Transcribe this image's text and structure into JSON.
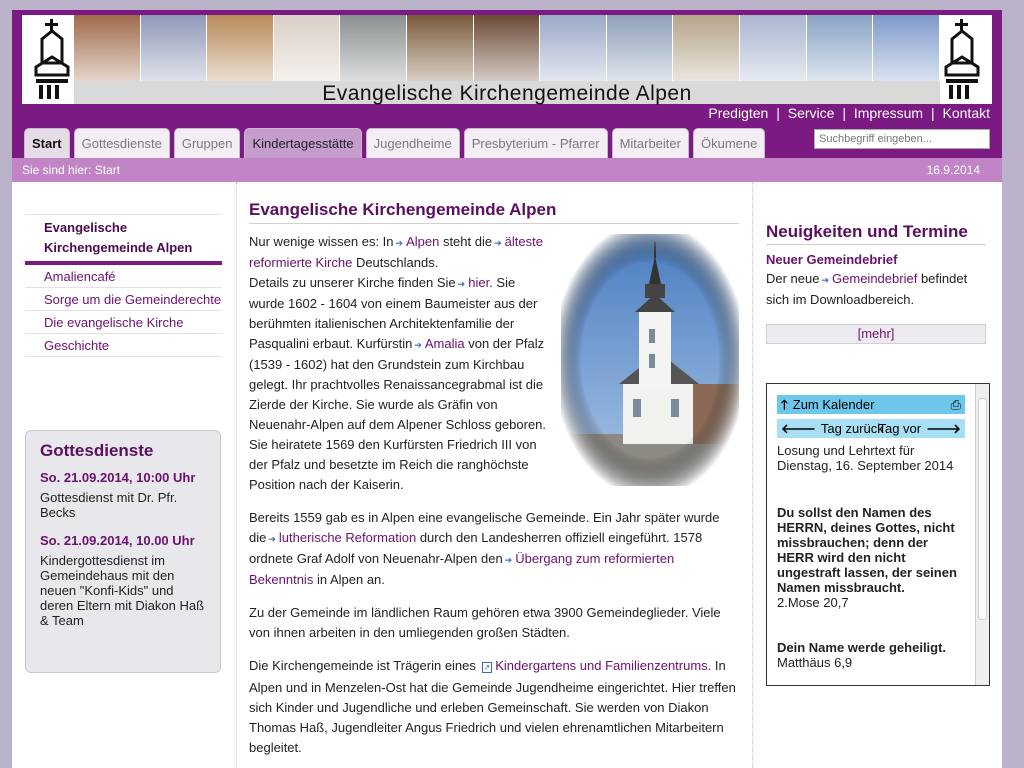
{
  "header": {
    "site_title": "Evangelische Kirchengemeinde Alpen",
    "photo_colors": [
      "#a06a4a",
      "#8f98b8",
      "#b88a5a",
      "#d9cfc4",
      "#8a8f90",
      "#7a5a3a",
      "#6b4a36",
      "#9aa9c8",
      "#8fa0b8",
      "#b5a48a",
      "#a9b6cf",
      "#8aa2c5",
      "#7e9acb"
    ]
  },
  "topnav": {
    "items": [
      "Predigten",
      "Service",
      "Impressum",
      "Kontakt"
    ],
    "separator": "|"
  },
  "tabs": [
    {
      "label": "Start"
    },
    {
      "label": "Gottesdienste"
    },
    {
      "label": "Gruppen"
    },
    {
      "label": "Kindertagesstätte"
    },
    {
      "label": "Jugendheime"
    },
    {
      "label": "Presbyterium - Pfarrer"
    },
    {
      "label": "Mitarbeiter"
    },
    {
      "label": "Ökumene"
    }
  ],
  "search": {
    "placeholder": "Suchbegriff eingeben..."
  },
  "breadcrumb": {
    "text": "Sie sind hier: Start",
    "date": "16.9.2014"
  },
  "sidebar": {
    "items": [
      {
        "label": "Evangelische Kirchengemeinde Alpen"
      },
      {
        "label": "Amaliencafé"
      },
      {
        "label": "Sorge um die Gemeinderechte"
      },
      {
        "label": "Die evangelische Kirche"
      },
      {
        "label": "Geschichte"
      }
    ],
    "gottesdienste": {
      "title": "Gottesdienste",
      "entries": [
        {
          "date": "So. 21.09.2014, 10:00 Uhr",
          "text": "Gottesdienst mit Dr. Pfr. Becks"
        },
        {
          "date": "So. 21.09.2014, 10.00 Uhr",
          "text": "Kindergottesdienst im Gemeindehaus mit den neuen \"Konfi-Kids\" und deren Eltern mit Diakon Haß & Team"
        }
      ]
    }
  },
  "main": {
    "title": "Evangelische Kirchengemeinde Alpen",
    "p1": {
      "t1": "Nur wenige wissen es: In",
      "l1": "Alpen",
      "t2": "steht die",
      "l2": "älteste reformierte Kirche",
      "t3": "Deutschlands.",
      "t4": "Details zu unserer Kirche finden Sie",
      "l3": "hier",
      "t5": ". Sie wurde 1602 - 1604 von einem Baumeister aus der berühmten italienischen Architektenfamilie der Pasqualini erbaut. Kurfürstin",
      "l4": "Amalia",
      "t6": "von der Pfalz (1539 - 1602) hat den Grundstein zum Kirchbau gelegt. Ihr prachtvolles Renaissancegrabmal ist die Zierde der Kirche. Sie wurde als Gräfin von Neuenahr-Alpen auf dem Alpener Schloss geboren. Sie heiratete 1569 den Kurfürsten Friedrich III von der Pfalz und besetzte im Reich die ranghöchste Position nach der Kaiserin."
    },
    "p2": {
      "t1": "Bereits 1559 gab es in Alpen eine evangelische Gemeinde. Ein Jahr später wurde die",
      "l1": "lutherische Reformation",
      "t2": "durch den Landesherren offiziell eingeführt. 1578 ordnete Graf Adolf von Neuenahr-Alpen den",
      "l2": "Übergang zum reformierten Bekenntnis",
      "t3": "in Alpen an."
    },
    "p3": "Zu der Gemeinde im ländlichen Raum gehören etwa 3900 Gemeindeglieder. Viele von ihnen arbeiten in den umliegenden großen Städten.",
    "p4": {
      "t1": "Die Kirchengemeinde ist Trägerin eines",
      "l1": "Kindergartens und Familienzentrums",
      "t2": ". In Alpen und in Menzelen-Ost hat die Gemeinde Jugendheime eingerichtet. Hier treffen sich Kinder und Jugendliche und erleben Gemeinschaft. Sie werden von Diakon Thomas Haß, Jugendleiter Angus Friedrich und vielen ehrenamtlichen Mitarbeitern begleitet."
    }
  },
  "news": {
    "title": "Neuigkeiten und Termine",
    "item_title": "Neuer Gemeindebrief",
    "t1": "Der neue",
    "link": "Gemeindebrief",
    "t2": "befindet sich im Downloadbereich.",
    "more": "[mehr]"
  },
  "calendar": {
    "to_calendar": "Zum Kalender",
    "prev": "Tag zurück",
    "next": "Tag vor",
    "heading": "Losung und Lehrtext für Dienstag, 16. September 2014",
    "losung": "Du sollst den Namen des HERRN, deines Gottes, nicht missbrauchen; denn der HERR wird den nicht ungestraft lassen, der seinen Namen missbraucht.",
    "losung_ref": "2.Mose 20,7",
    "lehrtext": "Dein Name werde geheiligt.",
    "lehrtext_ref": "Matthäus 6,9"
  },
  "colors": {
    "brand": "#7a1a82",
    "breadcrumb": "#c185c6",
    "link": "#6b116f",
    "calendar_button": "#6ec6ea"
  }
}
